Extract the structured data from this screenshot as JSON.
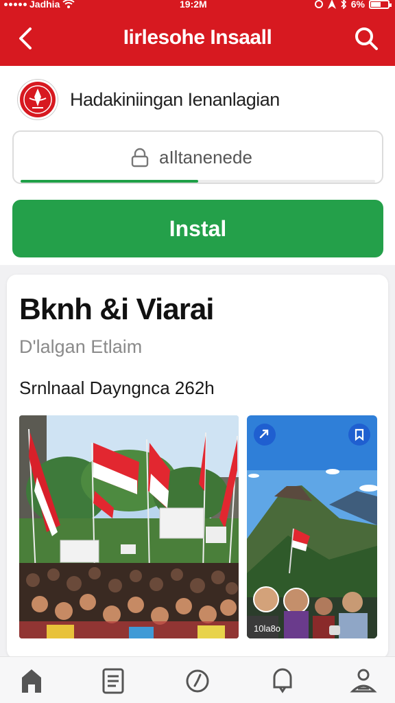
{
  "status_bar": {
    "carrier": "Jadhia",
    "time": "19:2M",
    "battery": "6%"
  },
  "app_bar": {
    "title": "Iirlesohe Insaall",
    "back_icon": "back-arrow-icon",
    "search_icon": "search-icon"
  },
  "publisher": {
    "name": "Hadakiniingan Ienanlagian",
    "emblem_icon": "emblem-logo"
  },
  "field": {
    "value": "aIltanenede",
    "icon": "lock-icon",
    "progress": 0.5
  },
  "install": {
    "label": "Instal"
  },
  "card": {
    "title": "Bknh &i Viarai",
    "subtitle": "D'lalgan Etlaim",
    "section": "Srnlnaal Dayngnca 262h",
    "image_left": "rally-crowd-flags-photo",
    "image_right": "mountain-flag-people-photo",
    "overlay_caption": "10la8o"
  },
  "tabs": [
    {
      "icon": "home-icon"
    },
    {
      "icon": "document-icon"
    },
    {
      "icon": "clock-icon"
    },
    {
      "icon": "bell-icon"
    },
    {
      "icon": "profile-icon"
    }
  ],
  "colors": {
    "brand_red": "#d71920",
    "install_green": "#24a04a",
    "accent_blue": "#1f5fd0"
  }
}
